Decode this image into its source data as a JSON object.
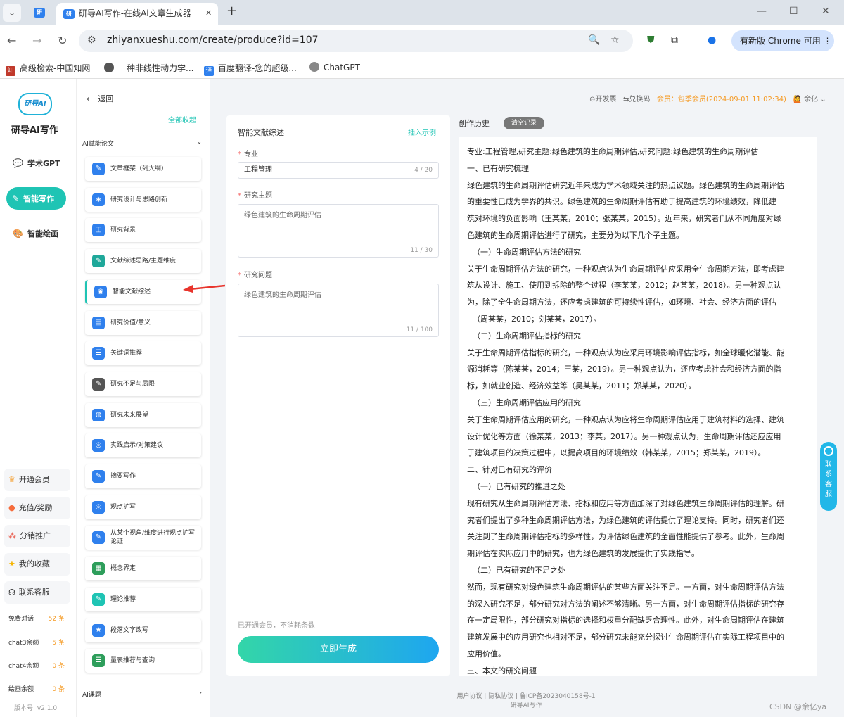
{
  "browser": {
    "tab_title": "研导AI写作-在线Ai文章生成器",
    "url": "zhiyanxueshu.com/create/produce?id=107",
    "update_label": "有新版 Chrome 可用",
    "bookmarks": [
      "高级检索-中国知网",
      "一种非线性动力学...",
      "百度翻译-您的超级...",
      "ChatGPT"
    ]
  },
  "side1": {
    "brand": "研导AI写作",
    "logo_text": "研导AI",
    "nav": [
      "学术GPT",
      "智能写作",
      "智能绘画"
    ],
    "boxes": [
      "开通会员",
      "充值/奖励",
      "分销推广",
      "我的收藏",
      "联系客服"
    ],
    "quota": [
      {
        "label": "免费对话",
        "value": "52 条"
      },
      {
        "label": "chat3余额",
        "value": "5 条"
      },
      {
        "label": "chat4余额",
        "value": "0 条"
      },
      {
        "label": "绘画余额",
        "value": "0 条"
      }
    ],
    "version": "版本号: v2.1.0"
  },
  "side2": {
    "back": "返回",
    "collapse_all": "全部收起",
    "group1": "AI赋能论文",
    "items": [
      "文章框架（列大纲）",
      "研究设计与思路创新",
      "研究背景",
      "文献综述思路/主题维度",
      "智能文献综述",
      "研究价值/意义",
      "关键词推荐",
      "研究不足与局限",
      "研究未来展望",
      "实践启示/对策建议",
      "摘要写作",
      "观点扩写",
      "从某个视角/维度进行观点扩写论证",
      "概念界定",
      "理论推荐",
      "段落文字改写",
      "量表推荐与查询"
    ],
    "group2": "AI课题"
  },
  "topbar": {
    "publish": "开发票",
    "exchange": "兑换码",
    "member": "会员：包季会员(2024-09-01 11:02:34)",
    "user": "余亿"
  },
  "form": {
    "title": "智能文献综述",
    "example": "插入示例",
    "major_label": "专业",
    "major_value": "工程管理",
    "major_count": "4 / 20",
    "topic_label": "研究主题",
    "topic_value": "绿色建筑的生命周期评估",
    "topic_count": "11 / 30",
    "question_label": "研究问题",
    "question_value": "绿色建筑的生命周期评估",
    "question_count": "11 / 100",
    "note": "已开通会员，不消耗条数",
    "generate": "立即生成"
  },
  "history": {
    "title": "创作历史",
    "clear": "清空记录",
    "lines": [
      "专业:工程管理,研究主题:绿色建筑的生命周期评估,研究问题:绿色建筑的生命周期评估",
      "一、已有研究梳理",
      "绿色建筑的生命周期评估研究近年来成为学术领域关注的热点议题。绿色建筑的生命周期评估",
      "的重要性已成为学界的共识。绿色建筑的生命周期评估有助于提高建筑的环境绩效，降低建",
      "筑对环境的负面影响（王某某，2010；张某某，2015）。近年来，研究者们从不同角度对绿",
      "色建筑的生命周期评估进行了研究，主要分为以下几个子主题。",
      "（一）生命周期评估方法的研究",
      "关于生命周期评估方法的研究，一种观点认为生命周期评估应采用全生命周期方法，即考虑建",
      "筑从设计、施工、使用到拆除的整个过程（李某某，2012；赵某某，2018）。另一种观点认",
      "为，除了全生命周期方法，还应考虑建筑的可持续性评估，如环境、社会、经济方面的评估",
      "（周某某，2010；刘某某，2017）。",
      "（二）生命周期评估指标的研究",
      "关于生命周期评估指标的研究，一种观点认为应采用环境影响评估指标，如全球暖化潜能、能",
      "源消耗等（陈某某，2014；王某，2019）。另一种观点认为，还应考虑社会和经济方面的指",
      "标，如就业创造、经济效益等（吴某某，2011；郑某某，2020）。",
      "（三）生命周期评估应用的研究",
      "关于生命周期评估应用的研究，一种观点认为应将生命周期评估应用于建筑材料的选择、建筑",
      "设计优化等方面（徐某某，2013；李某，2017）。另一种观点认为，生命周期评估还应应用",
      "于建筑项目的决策过程中，以提高项目的环境绩效（韩某某，2015；郑某某，2019）。",
      "二、针对已有研究的评价",
      "（一）已有研究的推进之处",
      "现有研究从生命周期评估方法、指标和应用等方面加深了对绿色建筑生命周期评估的理解。研",
      "究者们提出了多种生命周期评估方法，为绿色建筑的评估提供了理论支持。同时，研究者们还",
      "关注到了生命周期评估指标的多样性，为评估绿色建筑的全面性能提供了参考。此外，生命周",
      "期评估在实际应用中的研究，也为绿色建筑的发展提供了实践指导。",
      "（二）已有研究的不足之处",
      "然而，现有研究对绿色建筑生命周期评估的某些方面关注不足。一方面，对生命周期评估方法",
      "的深入研究不足，部分研究对方法的阐述不够清晰。另一方面，对生命周期评估指标的研究存",
      "在一定局限性，部分研究对指标的选择和权重分配缺乏合理性。此外，对生命周期评估在建筑",
      "建筑发展中的应用研究也相对不足，部分研究未能充分探讨生命周期评估在实际工程项目中的",
      "应用价值。",
      "三、本文的研究问题"
    ]
  },
  "footer": {
    "line1": "用户协议 | 隐私协议 | 鲁ICP备2023040158号-1",
    "line2": "研导AI写作"
  },
  "watermark": "CSDN @余亿ya",
  "service": "联系客服"
}
